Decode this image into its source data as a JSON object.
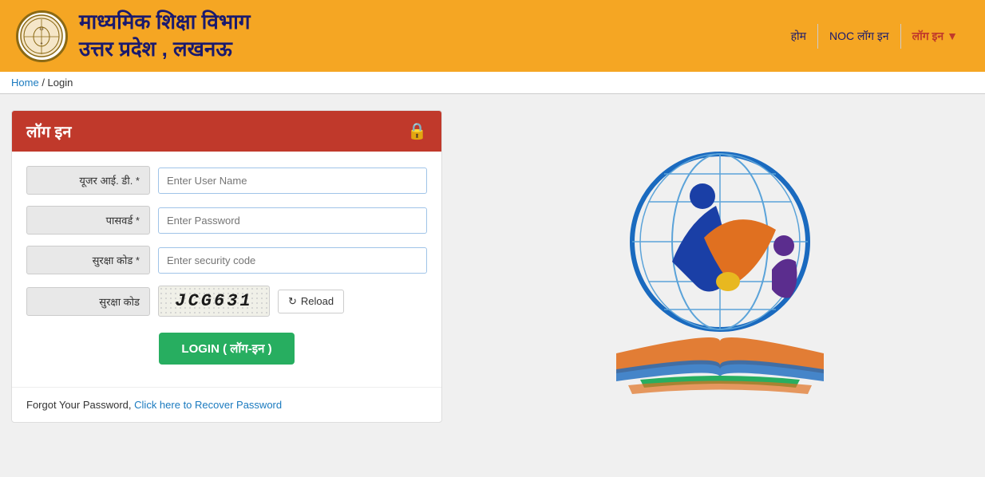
{
  "header": {
    "title_line1": "माध्यमिक शिक्षा विभाग",
    "title_line2": "उत्तर प्रदेश , लखनऊ",
    "nav": {
      "home": "होम",
      "noc_login": "NOC लॉग इन",
      "login": "लॉग इन"
    }
  },
  "breadcrumb": {
    "home": "Home",
    "separator": "/",
    "current": "Login"
  },
  "login_form": {
    "header_title": "लॉग इन",
    "fields": {
      "username_label": "यूजर आई. डी. *",
      "username_placeholder": "Enter User Name",
      "password_label": "पासवर्ड *",
      "password_placeholder": "Enter Password",
      "security_code_label": "सुरक्षा कोड *",
      "security_code_placeholder": "Enter security code",
      "captcha_label": "सुरक्षा कोड",
      "captcha_value": "JCG631",
      "reload_label": "Reload"
    },
    "login_button": "LOGIN ( लॉग-इन )",
    "forgot_text": "Forgot Your Password,",
    "forgot_link": "Click here to Recover Password"
  }
}
